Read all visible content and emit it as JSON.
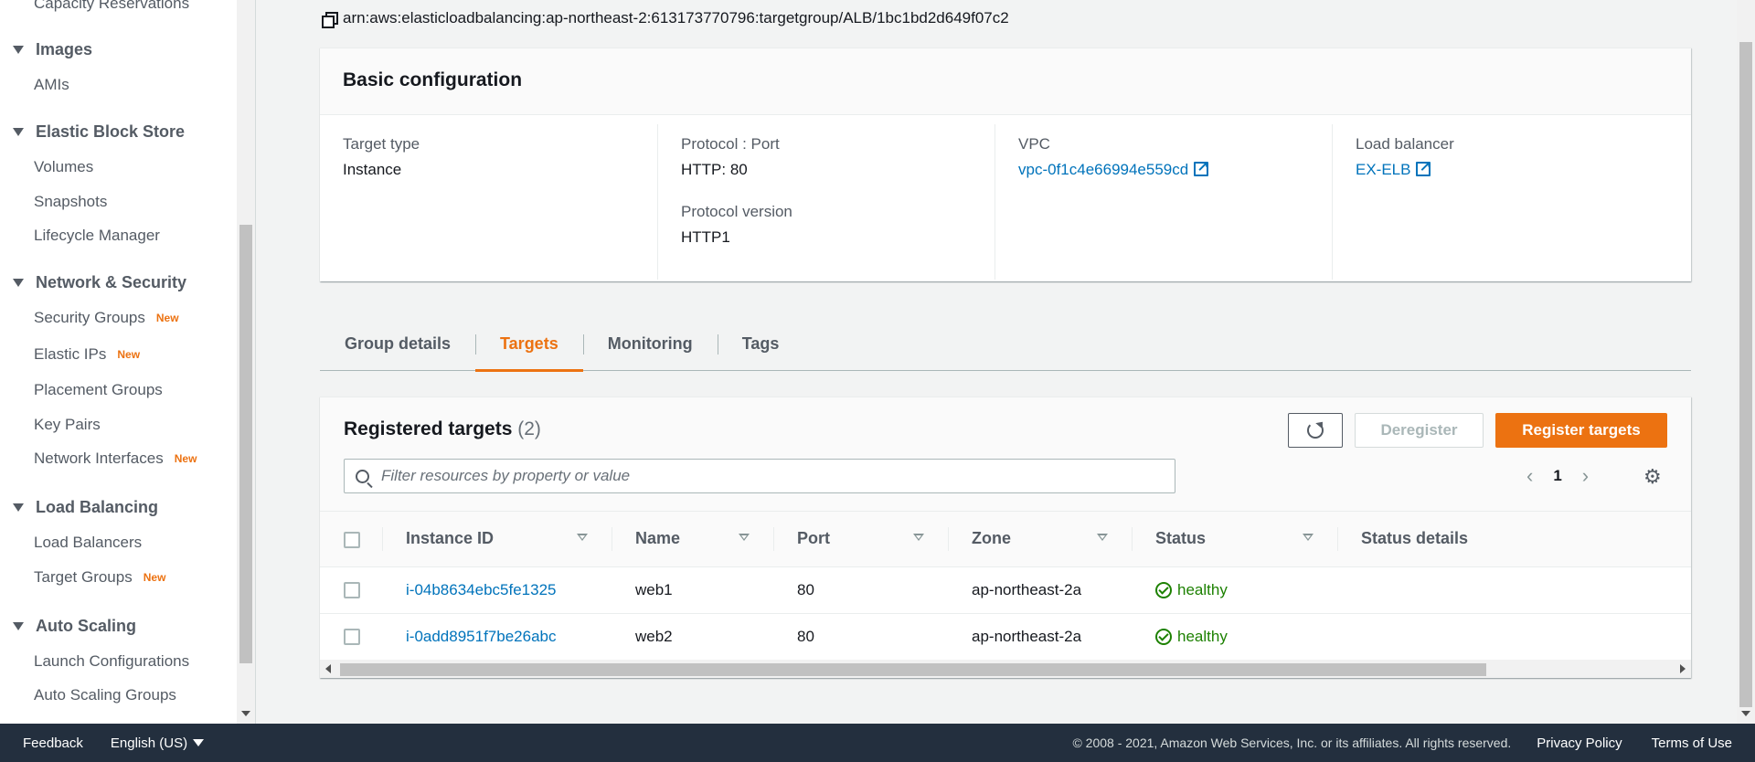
{
  "sidebar": {
    "top_item": "Capacity Reservations",
    "sections": [
      {
        "title": "Images",
        "items": [
          {
            "label": "AMIs",
            "new": ""
          }
        ]
      },
      {
        "title": "Elastic Block Store",
        "items": [
          {
            "label": "Volumes",
            "new": ""
          },
          {
            "label": "Snapshots",
            "new": ""
          },
          {
            "label": "Lifecycle Manager",
            "new": ""
          }
        ]
      },
      {
        "title": "Network & Security",
        "items": [
          {
            "label": "Security Groups",
            "new": "New"
          },
          {
            "label": "Elastic IPs",
            "new": "New"
          },
          {
            "label": "Placement Groups",
            "new": ""
          },
          {
            "label": "Key Pairs",
            "new": ""
          },
          {
            "label": "Network Interfaces",
            "new": "New"
          }
        ]
      },
      {
        "title": "Load Balancing",
        "items": [
          {
            "label": "Load Balancers",
            "new": ""
          },
          {
            "label": "Target Groups",
            "new": "New"
          }
        ]
      },
      {
        "title": "Auto Scaling",
        "items": [
          {
            "label": "Launch Configurations",
            "new": ""
          },
          {
            "label": "Auto Scaling Groups",
            "new": ""
          }
        ]
      }
    ]
  },
  "arn": "arn:aws:elasticloadbalancing:ap-northeast-2:613173770796:targetgroup/ALB/1bc1bd2d649f07c2",
  "basic": {
    "title": "Basic configuration",
    "target_type_label": "Target type",
    "target_type": "Instance",
    "protocol_port_label": "Protocol : Port",
    "protocol_port": "HTTP: 80",
    "protocol_version_label": "Protocol version",
    "protocol_version": "HTTP1",
    "vpc_label": "VPC",
    "vpc": "vpc-0f1c4e66994e559cd",
    "lb_label": "Load balancer",
    "lb": "EX-ELB"
  },
  "tabs": [
    "Group details",
    "Targets",
    "Monitoring",
    "Tags"
  ],
  "active_tab": "Targets",
  "targets": {
    "title": "Registered targets",
    "count": "(2)",
    "deregister_label": "Deregister",
    "register_label": "Register targets",
    "search_placeholder": "Filter resources by property or value",
    "page": "1",
    "columns": [
      "Instance ID",
      "Name",
      "Port",
      "Zone",
      "Status",
      "Status details"
    ],
    "rows": [
      {
        "instance_id": "i-04b8634ebc5fe1325",
        "name": "web1",
        "port": "80",
        "zone": "ap-northeast-2a",
        "status": "healthy",
        "details": ""
      },
      {
        "instance_id": "i-0add8951f7be26abc",
        "name": "web2",
        "port": "80",
        "zone": "ap-northeast-2a",
        "status": "healthy",
        "details": ""
      }
    ]
  },
  "footer": {
    "feedback": "Feedback",
    "language": "English (US)",
    "copyright": "© 2008 - 2021, Amazon Web Services, Inc. or its affiliates. All rights reserved.",
    "privacy": "Privacy Policy",
    "terms": "Terms of Use"
  },
  "colors": {
    "accent": "#ec7211",
    "link": "#0073bb",
    "healthy": "#1d8102",
    "footer_bg": "#232f3e"
  }
}
